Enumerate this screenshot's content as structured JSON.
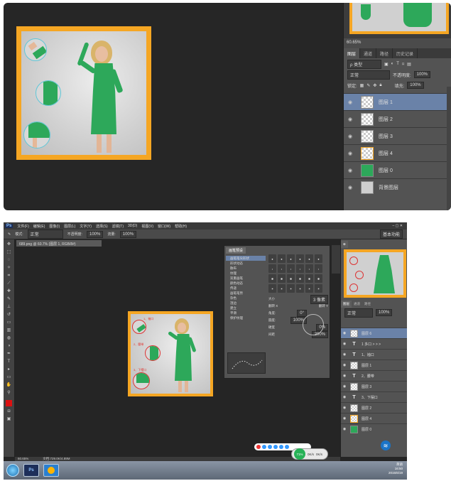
{
  "top": {
    "navigator": {
      "zoom": "60.65%"
    },
    "panel_tabs": [
      "图层",
      "通道",
      "路径",
      "历史记录"
    ],
    "filter": {
      "label": "ρ 类型"
    },
    "blend_mode": "正常",
    "opacity": {
      "label": "不透明度:",
      "value": "100%"
    },
    "lock": {
      "label": "锁定:"
    },
    "fill": {
      "label": "填充:",
      "value": "100%"
    },
    "layers": [
      {
        "name": "图层 1",
        "active": true
      },
      {
        "name": "图层 2"
      },
      {
        "name": "图层 3"
      },
      {
        "name": "图层 4"
      },
      {
        "name": "图层 0"
      },
      {
        "name": "背景图层"
      }
    ]
  },
  "ps": {
    "menu": [
      "文件(F)",
      "编辑(E)",
      "图像(I)",
      "图层(L)",
      "文字(Y)",
      "选择(S)",
      "滤镜(T)",
      "3D(D)",
      "视图(V)",
      "窗口(W)",
      "帮助(H)"
    ],
    "options": {
      "mode_label": "模式:",
      "mode_value": "正常",
      "opacity_label": "不透明度:",
      "opacity_value": "100%",
      "flow_label": "流量:",
      "flow_value": "100%",
      "workspace": "基本功能"
    },
    "doc_tab": "689.png @ 60.7% (图层 1, RGB/8#)",
    "brush_panel": {
      "tabs": [
        "画笔预设"
      ],
      "items": [
        "画笔笔尖形状",
        "形状动态",
        "散布",
        "纹理",
        "双重画笔",
        "颜色动态",
        "传递",
        "画笔笔势",
        "杂色",
        "湿边",
        "建立",
        "平滑",
        "保护纹理"
      ],
      "size_label": "大小",
      "size_value": "3 像素",
      "angle_label": "角度:",
      "angle_value": "0°",
      "roundness_label": "圆度:",
      "roundness_value": "100%",
      "hardness_label": "硬度",
      "hardness_value": "0%",
      "spacing_label": "间距",
      "spacing_value": "200%",
      "flip_x": "翻转 X",
      "flip_y": "翻转 Y"
    },
    "layers_tabs": [
      "图层",
      "通道",
      "路径"
    ],
    "layers_blend": "正常",
    "layers_opacity": "100%",
    "layers": [
      {
        "name": "图层 6",
        "type": "pixel",
        "active": true
      },
      {
        "name": "1 多口 > > >",
        "type": "text"
      },
      {
        "name": "1、袖口",
        "type": "text"
      },
      {
        "name": "图层 1",
        "type": "pixel"
      },
      {
        "name": "2、腰带",
        "type": "text"
      },
      {
        "name": "图层 3",
        "type": "pixel"
      },
      {
        "name": "3、下摆口",
        "type": "text"
      },
      {
        "name": "图层 2",
        "type": "pixel"
      },
      {
        "name": "图层 4",
        "type": "pixel"
      },
      {
        "name": "图层 0",
        "type": "pixel"
      }
    ],
    "status": {
      "zoom": "60.65%",
      "doc": "文档:729.0K/4.89M"
    },
    "net": {
      "pct": "71%",
      "up": "0K/s",
      "down": "0K/s"
    },
    "tray": {
      "time": "16:50",
      "date": "2015/6/19",
      "ime": "英语"
    },
    "taskbar_apps": [
      "Ps"
    ]
  },
  "annotations": [
    "1、袖口",
    "2、腰带",
    "3、下摆口"
  ],
  "colors": {
    "frame": "#f5a623",
    "dress": "#2da85a",
    "lens": "#5fc7d8",
    "active_layer": "#6a82a8"
  }
}
